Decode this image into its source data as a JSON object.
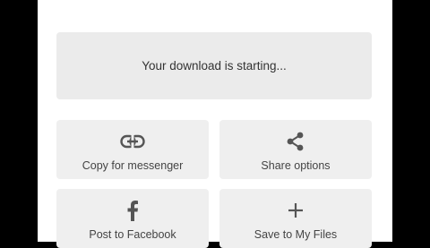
{
  "status": {
    "message": "Your download is starting..."
  },
  "actions": [
    {
      "label": "Copy for messenger",
      "icon": "link-icon"
    },
    {
      "label": "Share options",
      "icon": "share-icon"
    },
    {
      "label": "Post to Facebook",
      "icon": "facebook-icon"
    },
    {
      "label": "Save to My Files",
      "icon": "plus-icon"
    }
  ],
  "colors": {
    "background": "#000000",
    "panel": "#ffffff",
    "tile": "#efefef",
    "status_box": "#ebebeb",
    "icon": "#555555"
  }
}
